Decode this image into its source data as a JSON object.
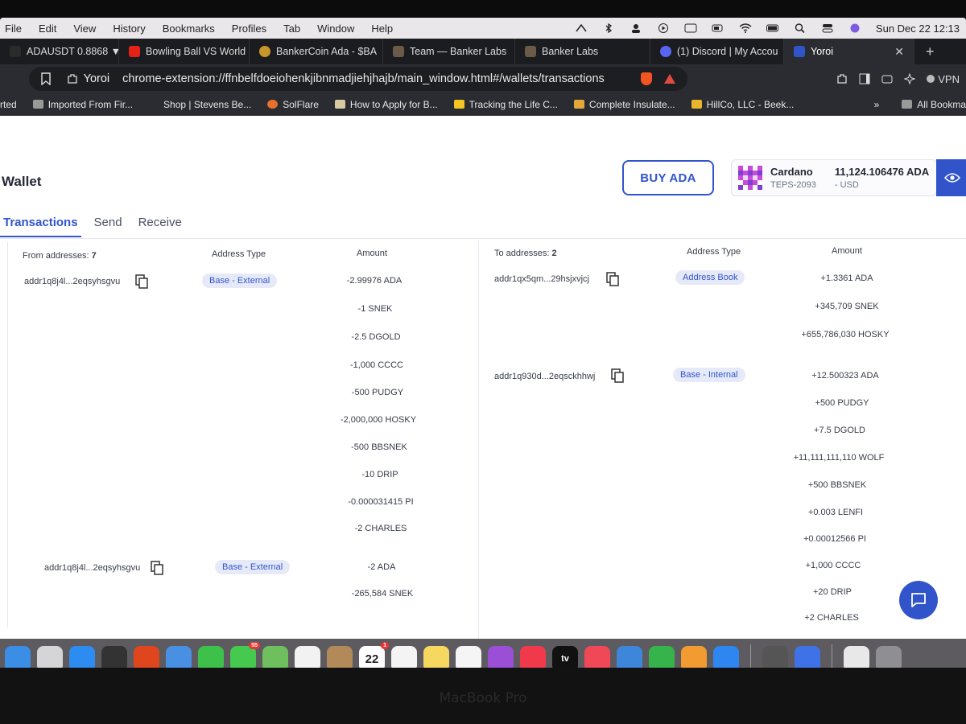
{
  "menubar": {
    "items": [
      "File",
      "Edit",
      "View",
      "History",
      "Bookmarks",
      "Profiles",
      "Tab",
      "Window",
      "Help"
    ],
    "datetime": "Sun Dec 22  12:13"
  },
  "tabs": [
    {
      "label": "ADAUSDT 0.8868 ▼ -",
      "color": "#2b2b2b"
    },
    {
      "label": "Bowling Ball VS World",
      "color": "#e62117"
    },
    {
      "label": "BankerCoin Ada - $BA",
      "color": "#c9962b"
    },
    {
      "label": "Team — Banker Labs",
      "color": "#6b5a48"
    },
    {
      "label": "Banker Labs",
      "color": "#6b5a48"
    },
    {
      "label": "(1) Discord | My Accou",
      "color": "#5865f2"
    },
    {
      "label": "Yoroi",
      "color": "#3154cb",
      "active": true
    }
  ],
  "address_bar": {
    "site": "Yoroi",
    "url": "chrome-extension://ffnbelfdoeiohenkjibnmadjiehjhajb/main_window.html#/wallets/transactions",
    "vpn_label": "VPN"
  },
  "bookmarks": {
    "items": [
      "rted",
      "Imported From Fir...",
      "Shop | Stevens Be...",
      "SolFlare",
      "How to Apply for B...",
      "Tracking the Life C...",
      "Complete Insulate...",
      "HillCo, LLC - Beek..."
    ],
    "overflow": "»",
    "all_label": "All Bookma"
  },
  "wallet": {
    "title": "Wallet",
    "buy_label": "BUY ADA",
    "name": "Cardano",
    "plate": "TEPS-2093",
    "balance": "11,124.106476 ADA",
    "usd": "- USD"
  },
  "page_tabs": [
    "Transactions",
    "Send",
    "Receive"
  ],
  "from": {
    "header_label": "From addresses:",
    "count": "7",
    "col_type": "Address Type",
    "col_amount": "Amount",
    "rows": [
      {
        "address": "addr1q8j4l...2eqsyhsgvu",
        "type": "Base - External"
      },
      {
        "address": "addr1q8j4l...2eqsyhsgvu",
        "type": "Base - External"
      }
    ],
    "amounts": [
      "-2.99976 ADA",
      "-1 SNEK",
      "-2.5 DGOLD",
      "-1,000 CCCC",
      "-500 PUDGY",
      "-2,000,000 HOSKY",
      "-500 BBSNEK",
      "-10 DRIP",
      "-0.000031415 PI",
      "-2 CHARLES",
      "-2 ADA",
      "-265,584 SNEK"
    ]
  },
  "to": {
    "header_label": "To addresses:",
    "count": "2",
    "col_type": "Address Type",
    "col_amount": "Amount",
    "rows": [
      {
        "address": "addr1qx5qm...29hsjxvjcj",
        "type": "Address Book"
      },
      {
        "address": "addr1q930d...2eqsckhhwj",
        "type": "Base - Internal"
      }
    ],
    "amounts": [
      "+1.3361 ADA",
      "+345,709 SNEK",
      "+655,786,030 HOSKY",
      "+12.500323 ADA",
      "+500 PUDGY",
      "+7.5 DGOLD",
      "+11,111,111,110 WOLF",
      "+500 BBSNEK",
      "+0.003 LENFI",
      "+0.00012566 PI",
      "+1,000 CCCC",
      "+20 DRIP",
      "+2 CHARLES"
    ]
  },
  "dock": {
    "apps": [
      {
        "name": "finder",
        "color": "#3a8ee6"
      },
      {
        "name": "launchpad",
        "color": "#d5d5d8"
      },
      {
        "name": "safari",
        "color": "#2d8cf0"
      },
      {
        "name": "screenshot",
        "color": "#333333"
      },
      {
        "name": "brave",
        "color": "#e0461d"
      },
      {
        "name": "mail",
        "color": "#4a90e2"
      },
      {
        "name": "facetime",
        "color": "#3ec14a"
      },
      {
        "name": "messages",
        "color": "#45c94f",
        "badge": "55"
      },
      {
        "name": "maps",
        "color": "#6fbf5f"
      },
      {
        "name": "photos",
        "color": "#f2f2f2"
      },
      {
        "name": "contacts",
        "color": "#b28a5a"
      },
      {
        "name": "calendar",
        "color": "#ffffff",
        "text": "22",
        "badge": "1"
      },
      {
        "name": "reminders",
        "color": "#f4f4f4"
      },
      {
        "name": "notes",
        "color": "#f6d860"
      },
      {
        "name": "freeform",
        "color": "#f5f5f5"
      },
      {
        "name": "podcasts",
        "color": "#9a4fd6"
      },
      {
        "name": "music",
        "color": "#f03a4c"
      },
      {
        "name": "tv",
        "color": "#111111",
        "text": "tv"
      },
      {
        "name": "news",
        "color": "#f04856"
      },
      {
        "name": "keynote",
        "color": "#3d86d9"
      },
      {
        "name": "numbers",
        "color": "#36b34a"
      },
      {
        "name": "pages",
        "color": "#f29b30"
      },
      {
        "name": "app-store",
        "color": "#2e86f0"
      },
      {
        "name": "calculator",
        "color": "#555555"
      },
      {
        "name": "nordvpn",
        "color": "#3f72e6"
      },
      {
        "name": "document",
        "color": "#e8e8e8"
      },
      {
        "name": "trash",
        "color": "#8f8f93"
      }
    ]
  },
  "laptop_brand": "MacBook Pro"
}
